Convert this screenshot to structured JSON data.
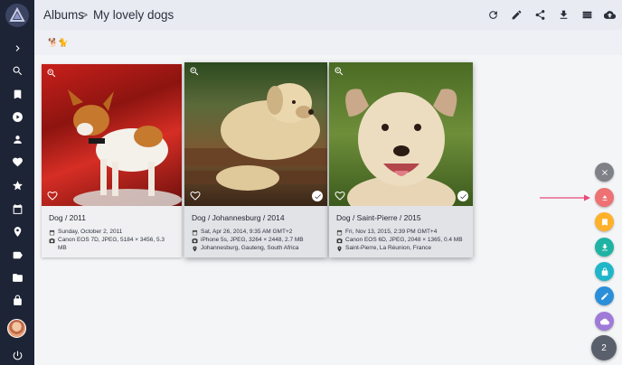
{
  "header": {
    "root": "Albums",
    "separator": ">",
    "current": "My lovely dogs"
  },
  "subbar": {
    "emoji": "🐕🐈"
  },
  "sidebar": {
    "items": [
      "expand",
      "search",
      "bookmark",
      "play",
      "person",
      "favorite",
      "star",
      "calendar",
      "place",
      "label",
      "folder",
      "lock",
      "avatar",
      "power"
    ]
  },
  "toolbar": {
    "icons": [
      "refresh-icon",
      "edit-icon",
      "share-icon",
      "download-icon",
      "view-list-icon",
      "upload-icon"
    ]
  },
  "cards": [
    {
      "title": "Dog / 2011",
      "date": "Sunday, October 2, 2011",
      "camera": "Canon EOS 7D, JPEG, 5184 × 3456, 5.3 MB",
      "location": "",
      "selected": false
    },
    {
      "title": "Dog / Johannesburg / 2014",
      "date": "Sat, Apr 26, 2014, 9:35 AM GMT+2",
      "camera": "iPhone 5s, JPEG, 3264 × 2448, 2.7 MB",
      "location": "Johannesburg, Gauteng, South Africa",
      "selected": true
    },
    {
      "title": "Dog / Saint-Pierre / 2015",
      "date": "Fri, Nov 13, 2015, 2:39 PM GMT+4",
      "camera": "Canon EOS 6D, JPEG, 2048 × 1365, 0.4 MB",
      "location": "Saint-Pierre, La Réunion, France",
      "selected": true
    }
  ],
  "fabs": [
    {
      "name": "close-icon",
      "color": "#7f8189"
    },
    {
      "name": "archive-icon",
      "color": "#ee7273"
    },
    {
      "name": "bookmark-icon",
      "color": "#ffb12a"
    },
    {
      "name": "download-icon",
      "color": "#1fb3a3"
    },
    {
      "name": "lock-icon",
      "color": "#1fb6c9"
    },
    {
      "name": "edit-icon",
      "color": "#2a8fd8"
    },
    {
      "name": "cloud-icon",
      "color": "#a07ad8"
    }
  ],
  "selection_count": "2",
  "accent": "#e84a78"
}
